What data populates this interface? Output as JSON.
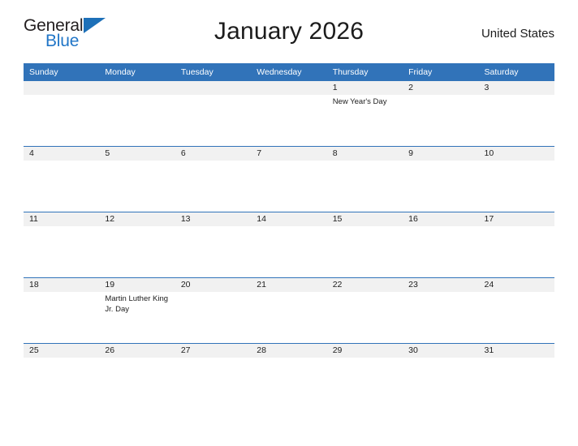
{
  "brand": {
    "name_part1": "General",
    "name_part2": "Blue",
    "flag_icon": "triangle-flag-icon",
    "accent_color": "#2176c7"
  },
  "header": {
    "title": "January 2026",
    "locale": "United States"
  },
  "theme": {
    "header_blue": "#3173b9",
    "date_band_gray": "#f1f1f1",
    "text_color": "#1c1c1c"
  },
  "calendar": {
    "month": "January",
    "year": "2026",
    "weekday_headers": [
      "Sunday",
      "Monday",
      "Tuesday",
      "Wednesday",
      "Thursday",
      "Friday",
      "Saturday"
    ],
    "weeks": [
      [
        {
          "day": "",
          "events": []
        },
        {
          "day": "",
          "events": []
        },
        {
          "day": "",
          "events": []
        },
        {
          "day": "",
          "events": []
        },
        {
          "day": "1",
          "events": [
            "New Year's Day"
          ]
        },
        {
          "day": "2",
          "events": []
        },
        {
          "day": "3",
          "events": []
        }
      ],
      [
        {
          "day": "4",
          "events": []
        },
        {
          "day": "5",
          "events": []
        },
        {
          "day": "6",
          "events": []
        },
        {
          "day": "7",
          "events": []
        },
        {
          "day": "8",
          "events": []
        },
        {
          "day": "9",
          "events": []
        },
        {
          "day": "10",
          "events": []
        }
      ],
      [
        {
          "day": "11",
          "events": []
        },
        {
          "day": "12",
          "events": []
        },
        {
          "day": "13",
          "events": []
        },
        {
          "day": "14",
          "events": []
        },
        {
          "day": "15",
          "events": []
        },
        {
          "day": "16",
          "events": []
        },
        {
          "day": "17",
          "events": []
        }
      ],
      [
        {
          "day": "18",
          "events": []
        },
        {
          "day": "19",
          "events": [
            "Martin Luther King Jr. Day"
          ]
        },
        {
          "day": "20",
          "events": []
        },
        {
          "day": "21",
          "events": []
        },
        {
          "day": "22",
          "events": []
        },
        {
          "day": "23",
          "events": []
        },
        {
          "day": "24",
          "events": []
        }
      ],
      [
        {
          "day": "25",
          "events": []
        },
        {
          "day": "26",
          "events": []
        },
        {
          "day": "27",
          "events": []
        },
        {
          "day": "28",
          "events": []
        },
        {
          "day": "29",
          "events": []
        },
        {
          "day": "30",
          "events": []
        },
        {
          "day": "31",
          "events": []
        }
      ]
    ]
  }
}
